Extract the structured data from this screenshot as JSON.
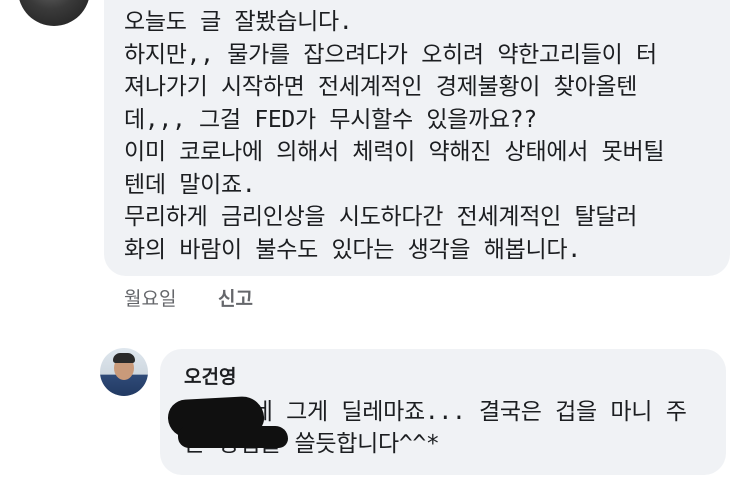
{
  "comment": {
    "lines": [
      "오늘도 글 잘봤습니다.",
      "하지만,, 물가를 잡으려다가 오히려 약한고리들이 터",
      "져나가기 시작하면 전세계적인 경제불황이 찾아올텐",
      "데,,, 그걸 FED가 무시할수 있을까요??",
      "이미 코로나에 의해서 체력이 약해진 상태에서 못버틸",
      "텐데 말이죠.",
      "무리하게 금리인상을 시도하다간 전세계적인 탈달러",
      "화의 바람이 불수도 있다는 생각을 해봅니다."
    ],
    "time": "월요일",
    "report_label": "신고"
  },
  "reply": {
    "author": "오건영",
    "lines": [
      "     네 그게 딜레마죠... 결국은 겁을 마니 주",
      "는 방법을 쓸듯합니다^^*"
    ]
  }
}
